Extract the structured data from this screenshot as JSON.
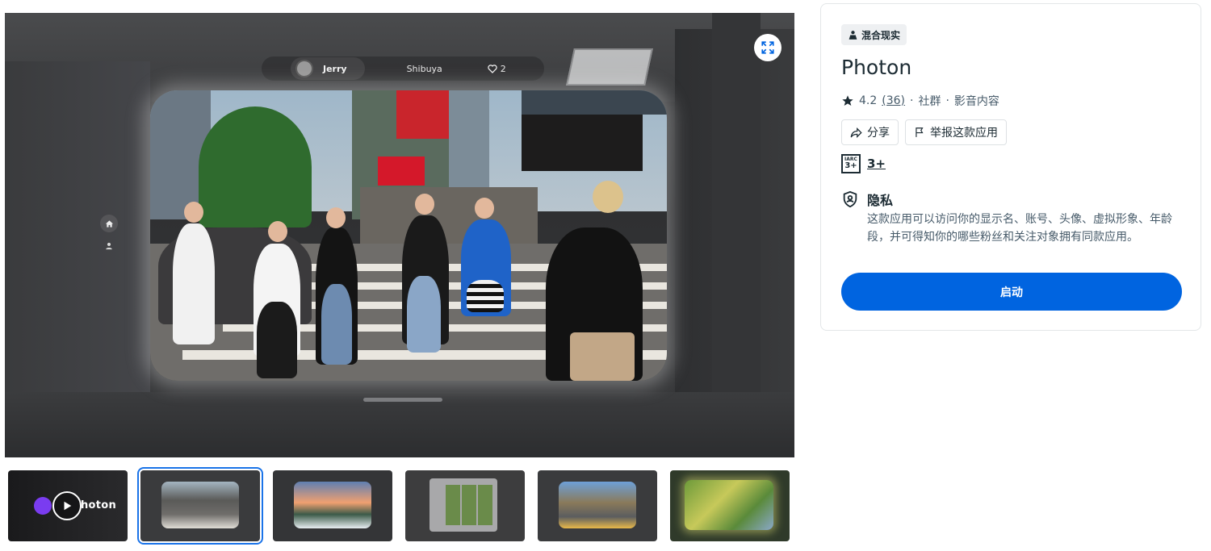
{
  "viewer": {
    "user_name": "Jerry",
    "location": "Shibuya",
    "like_count": "2",
    "fullscreen_icon": "expand-icon",
    "home_icon": "home-icon",
    "profile_icon": "person-icon"
  },
  "thumbnails": {
    "items": [
      {
        "label": "hoton",
        "kind": "video",
        "selected": false
      },
      {
        "label": "",
        "kind": "image",
        "selected": true
      },
      {
        "label": "",
        "kind": "image",
        "selected": false
      },
      {
        "label": "",
        "kind": "image",
        "selected": false
      },
      {
        "label": "",
        "kind": "image",
        "selected": false
      },
      {
        "label": "",
        "kind": "image",
        "selected": false
      }
    ]
  },
  "app": {
    "category_tag": "混合现实",
    "title": "Photon",
    "rating": "4.2",
    "review_count": "(36)",
    "genre_1": "社群",
    "genre_2": "影音内容",
    "share_label": "分享",
    "report_label": "举报这款应用",
    "age_rating": "3+",
    "age_badge_top": "IARC",
    "age_badge_num": "3+",
    "privacy_title": "隐私",
    "privacy_text": "这款应用可以访问你的显示名、账号、头像、虚拟形象、年龄段，并可得知你的哪些粉丝和关注对象拥有同款应用。",
    "launch_label": "启动",
    "accent_color": "#0064e0"
  }
}
